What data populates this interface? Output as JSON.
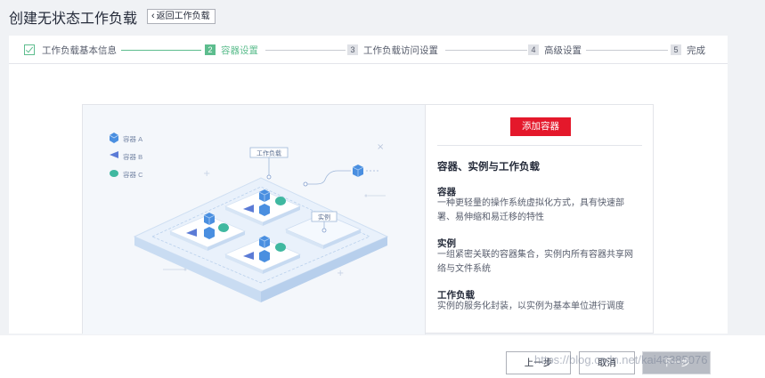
{
  "header": {
    "title": "创建无状态工作负载",
    "back_label": "返回工作负载"
  },
  "steps": [
    {
      "label": "工作负载基本信息",
      "state": "done"
    },
    {
      "num": "2",
      "label": "容器设置",
      "state": "active"
    },
    {
      "num": "3",
      "label": "工作负载访问设置",
      "state": "todo"
    },
    {
      "num": "4",
      "label": "高级设置",
      "state": "todo"
    },
    {
      "num": "5",
      "label": "完成",
      "state": "todo"
    }
  ],
  "illustration": {
    "legend": [
      "容器 A",
      "容器 B",
      "容器 C"
    ],
    "label_workload": "工作负载",
    "label_instance": "实例"
  },
  "info": {
    "add_button": "添加容器",
    "title": "容器、实例与工作负载",
    "sections": [
      {
        "heading": "容器",
        "desc": "一种更轻量的操作系统虚拟化方式，具有快速部署、易伸缩和易迁移的特性"
      },
      {
        "heading": "实例",
        "desc": "一组紧密关联的容器集合，实例内所有容器共享网络与文件系统"
      },
      {
        "heading": "工作负载",
        "desc": "实例的服务化封装，以实例为基本单位进行调度"
      }
    ]
  },
  "footer": {
    "prev": "上一步",
    "cancel": "取消",
    "next": "下一步"
  },
  "watermark": "https://blog.csdn.net/kai46385076",
  "colors": {
    "accent_green": "#5dbd8e",
    "add_red": "#e4182b",
    "disabled_gray": "#b8bcc4"
  }
}
